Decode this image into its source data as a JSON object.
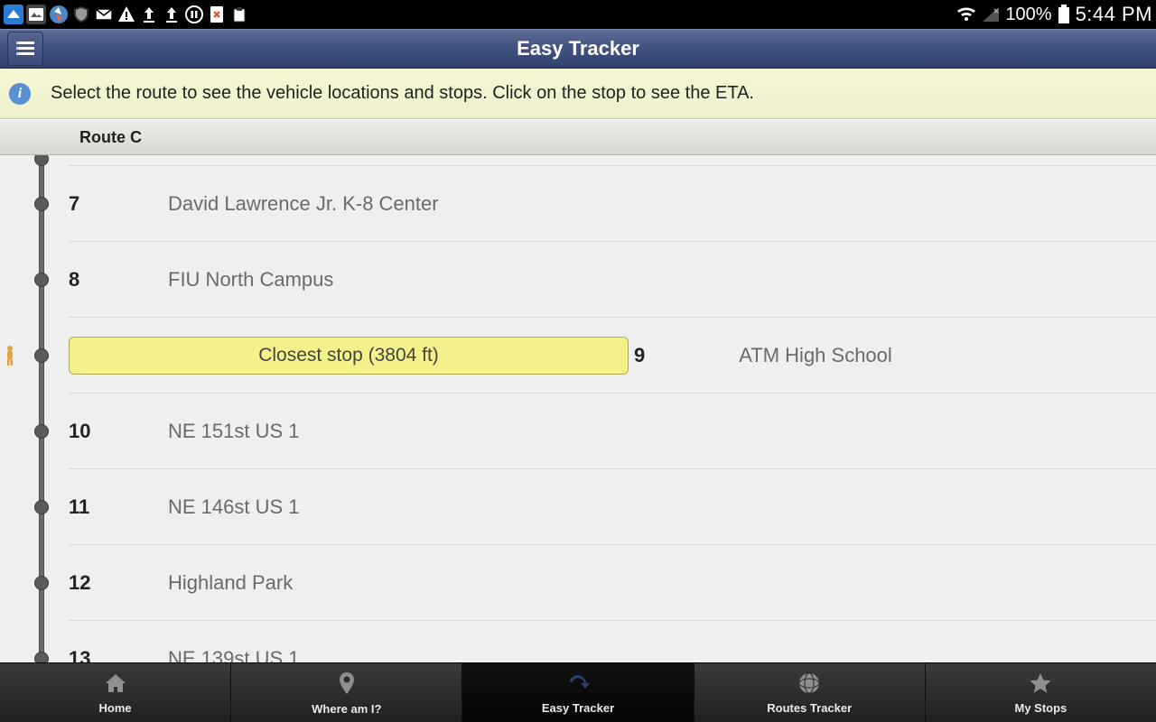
{
  "status": {
    "battery_pct": "100%",
    "time": "5:44 PM"
  },
  "header": {
    "title": "Easy Tracker"
  },
  "info": {
    "text": "Select the route to see the vehicle locations and stops. Click on the stop to see the ETA."
  },
  "route": {
    "label": "Route C"
  },
  "closest": {
    "label": "Closest stop (3804 ft)"
  },
  "stops": [
    {
      "num": "7",
      "name": "David Lawrence Jr. K-8 Center",
      "closest": false
    },
    {
      "num": "8",
      "name": "FIU North Campus",
      "closest": false
    },
    {
      "num": "9",
      "name": "ATM High School",
      "closest": true
    },
    {
      "num": "10",
      "name": "NE 151st US 1",
      "closest": false
    },
    {
      "num": "11",
      "name": "NE 146st US 1",
      "closest": false
    },
    {
      "num": "12",
      "name": "Highland Park",
      "closest": false
    },
    {
      "num": "13",
      "name": "NE 139st US 1",
      "closest": false
    }
  ],
  "tabs": [
    {
      "label": "Home",
      "icon": "home-icon",
      "active": false
    },
    {
      "label": "Where am I?",
      "icon": "pin-icon",
      "active": false
    },
    {
      "label": "Easy Tracker",
      "icon": "refresh-icon",
      "active": true
    },
    {
      "label": "Routes Tracker",
      "icon": "globe-icon",
      "active": false
    },
    {
      "label": "My Stops",
      "icon": "star-icon",
      "active": false
    }
  ]
}
